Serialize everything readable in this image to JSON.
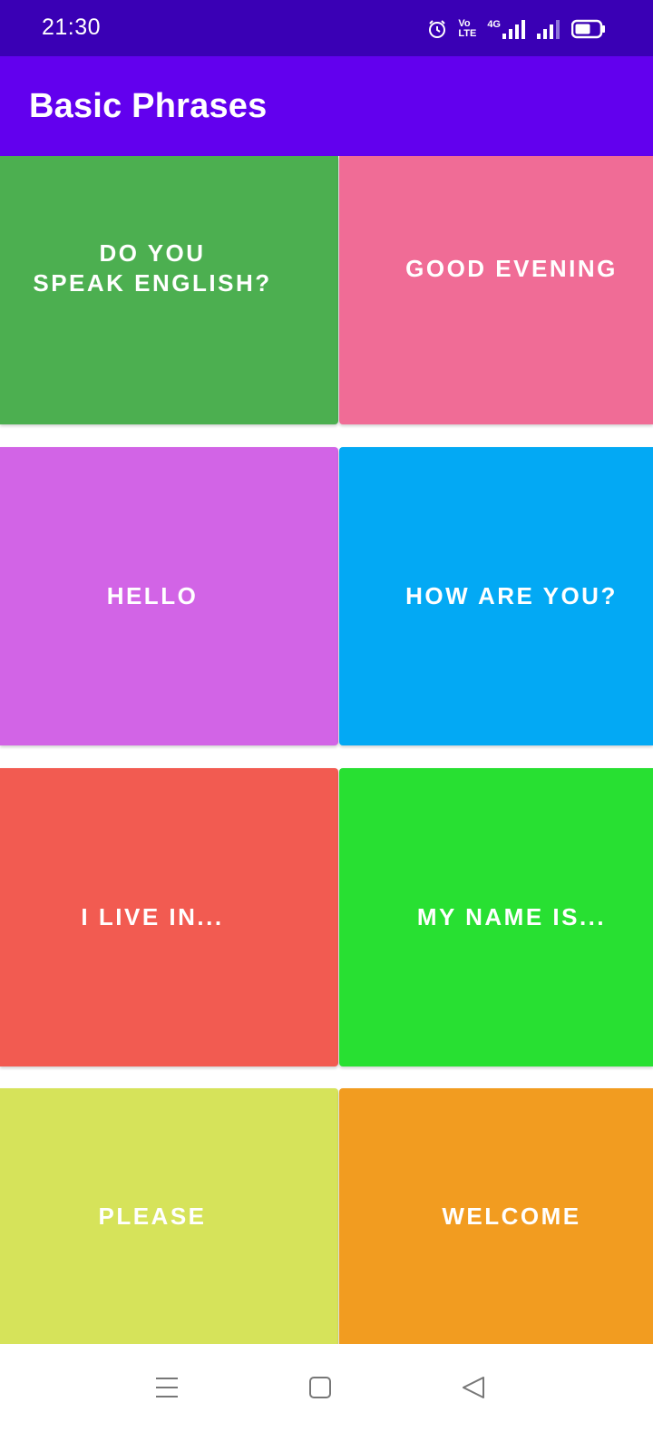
{
  "status_bar": {
    "time": "21:30",
    "icons": [
      "alarm-icon",
      "volte-icon",
      "4g-signal-icon",
      "signal-icon",
      "battery-icon"
    ],
    "network_label": "4G",
    "volte_label_top": "Vo",
    "volte_label_bottom": "LTE",
    "background": "#3a00b5"
  },
  "app_bar": {
    "title": "Basic Phrases",
    "background": "#6200ee"
  },
  "phrases": [
    {
      "label": "DO YOU\nSPEAK ENGLISH?",
      "color": "#4caf50"
    },
    {
      "label": "GOOD EVENING",
      "color": "#f06c96"
    },
    {
      "label": "HELLO",
      "color": "#d264e6"
    },
    {
      "label": "HOW ARE YOU?",
      "color": "#03a9f4"
    },
    {
      "label": "I LIVE IN...",
      "color": "#f25b51"
    },
    {
      "label": "MY NAME IS...",
      "color": "#28e032"
    },
    {
      "label": "PLEASE",
      "color": "#d6e35a"
    },
    {
      "label": "WELCOME",
      "color": "#f29c20"
    }
  ],
  "nav_bar": {
    "buttons": [
      "menu-icon",
      "home-icon",
      "back-icon"
    ]
  }
}
